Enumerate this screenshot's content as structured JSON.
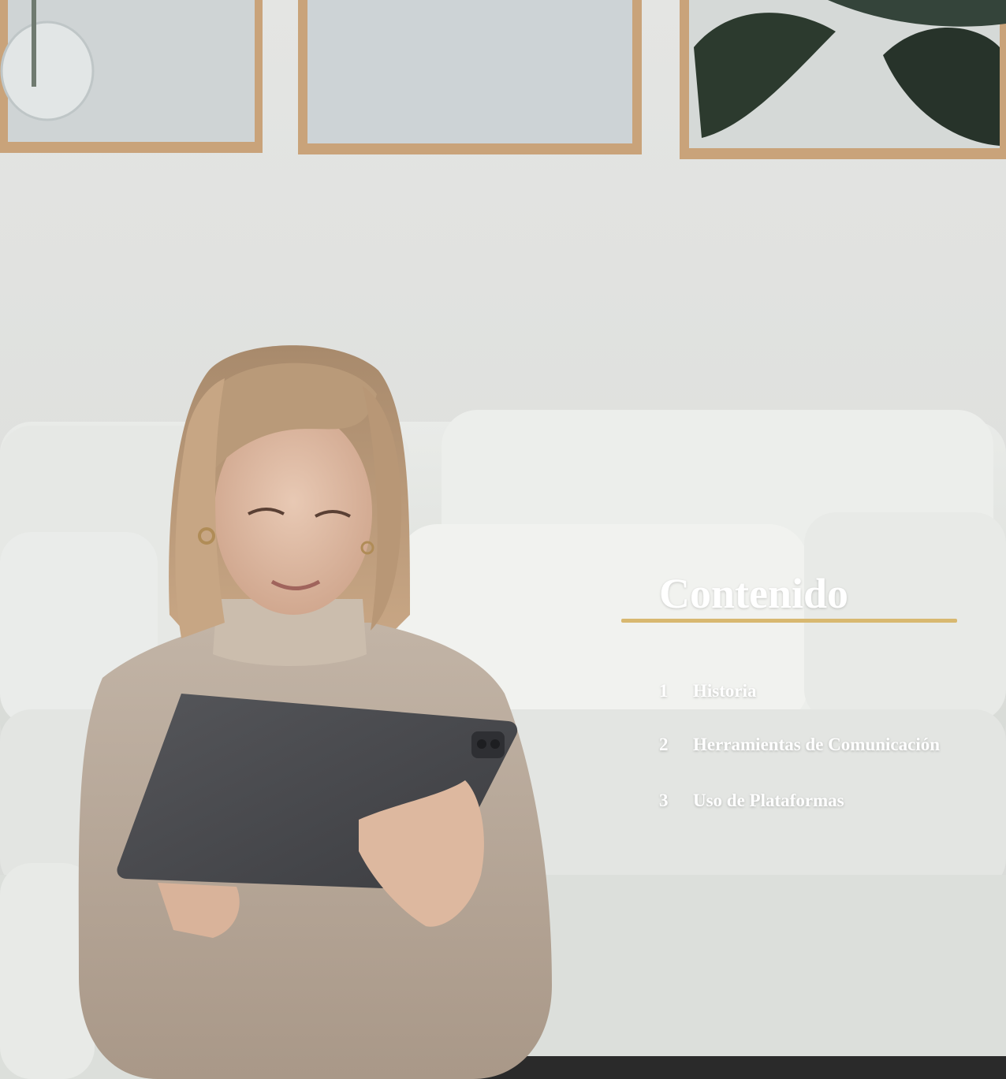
{
  "toc": {
    "title": "Contenido",
    "items": [
      {
        "number": "1",
        "label": "Historia"
      },
      {
        "number": "2",
        "label": "Herramientas de Comunicación"
      },
      {
        "number": "3",
        "label": "Uso de Plataformas"
      }
    ]
  },
  "colors": {
    "accent_rule": "#d8b870",
    "text": "#ffffff"
  },
  "background": {
    "picture": "woman-with-tablet-on-sofa-photo"
  }
}
